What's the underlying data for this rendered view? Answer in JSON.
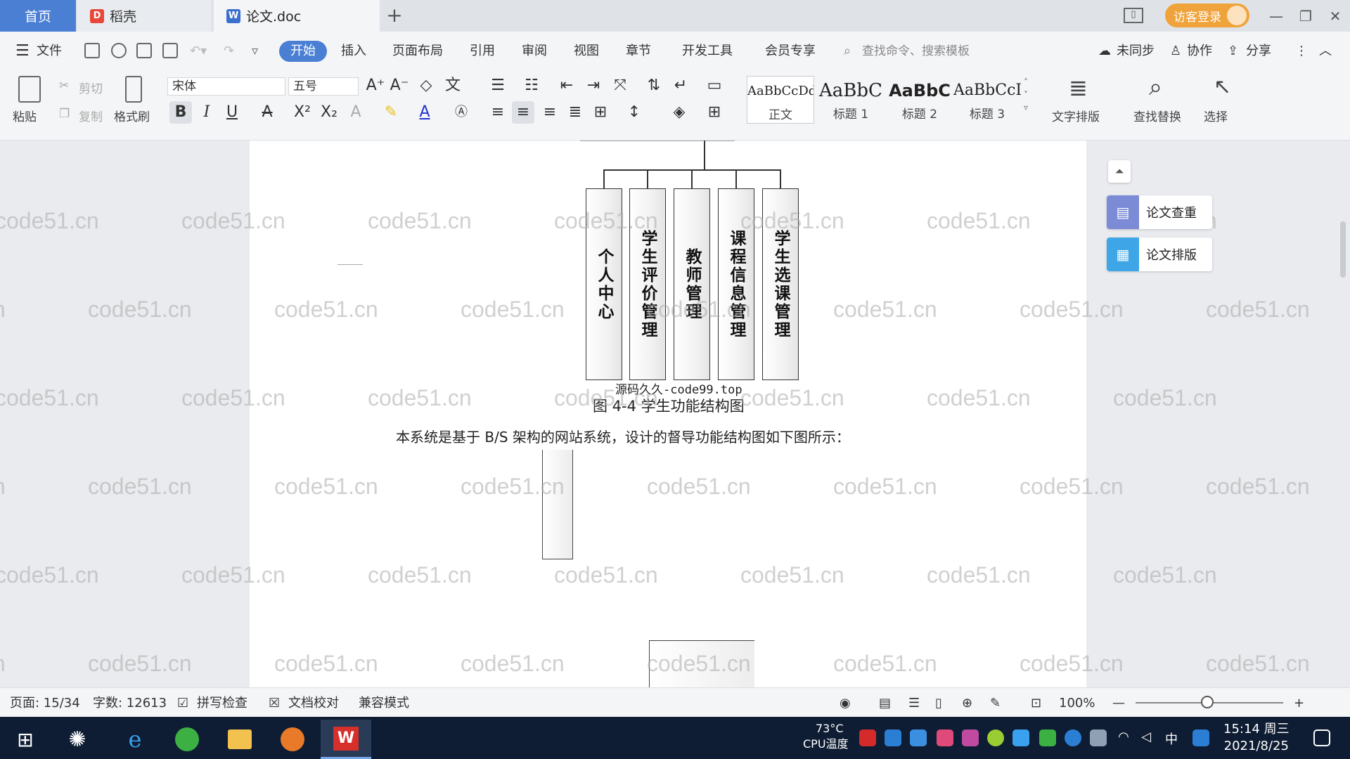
{
  "tabs": [
    {
      "label": "首页"
    },
    {
      "label": "稻壳"
    },
    {
      "label": "论文.doc"
    }
  ],
  "titlebar": {
    "login_label": "访客登录"
  },
  "menu": {
    "file": "文件",
    "items": [
      "开始",
      "插入",
      "页面布局",
      "引用",
      "审阅",
      "视图",
      "章节",
      "开发工具",
      "会员专享"
    ],
    "search_placeholder": "查找命令、搜索模板",
    "unsync": "未同步",
    "collab": "协作",
    "share": "分享"
  },
  "ribbon": {
    "paste": "粘贴",
    "cut": "剪切",
    "copy": "复制",
    "format_painter": "格式刷",
    "font_name": "宋体",
    "font_size": "五号",
    "styles": [
      {
        "sample": "AaBbCcDd",
        "name": "正文"
      },
      {
        "sample": "AaBbC",
        "name": "标题 1"
      },
      {
        "sample": "AaBbC",
        "name": "标题 2"
      },
      {
        "sample": "AaBbCcI",
        "name": "标题 3"
      }
    ],
    "text_layout": "文字排版",
    "find_replace": "查找替换",
    "select": "选择"
  },
  "document": {
    "diagram_boxes": [
      "个人中心",
      "学生评价管理",
      "教师管理",
      "课程信息管理",
      "学生选课管理"
    ],
    "source_caption": "源码久久-code99.top",
    "figure_caption": "图 4-4  学生功能结构图",
    "body_text": "本系统是基于 B/S 架构的网站系统，设计的督导功能结构图如下图所示：",
    "watermark": "code51.cn"
  },
  "side_panel": {
    "check": "论文查重",
    "layout": "论文排版"
  },
  "statusbar": {
    "page": "页面: 15/34",
    "words": "字数: 12613",
    "spell": "拼写检查",
    "proof": "文档校对",
    "compat": "兼容模式",
    "zoom": "100%"
  },
  "taskbar": {
    "cpu_temp": "73°C",
    "cpu_label": "CPU温度",
    "ime": "中",
    "time": "15:14 周三",
    "date": "2021/8/25"
  },
  "colors": {
    "accent": "#4a7fd4",
    "login": "#f0a33a",
    "taskbar": "#0e1d33"
  }
}
